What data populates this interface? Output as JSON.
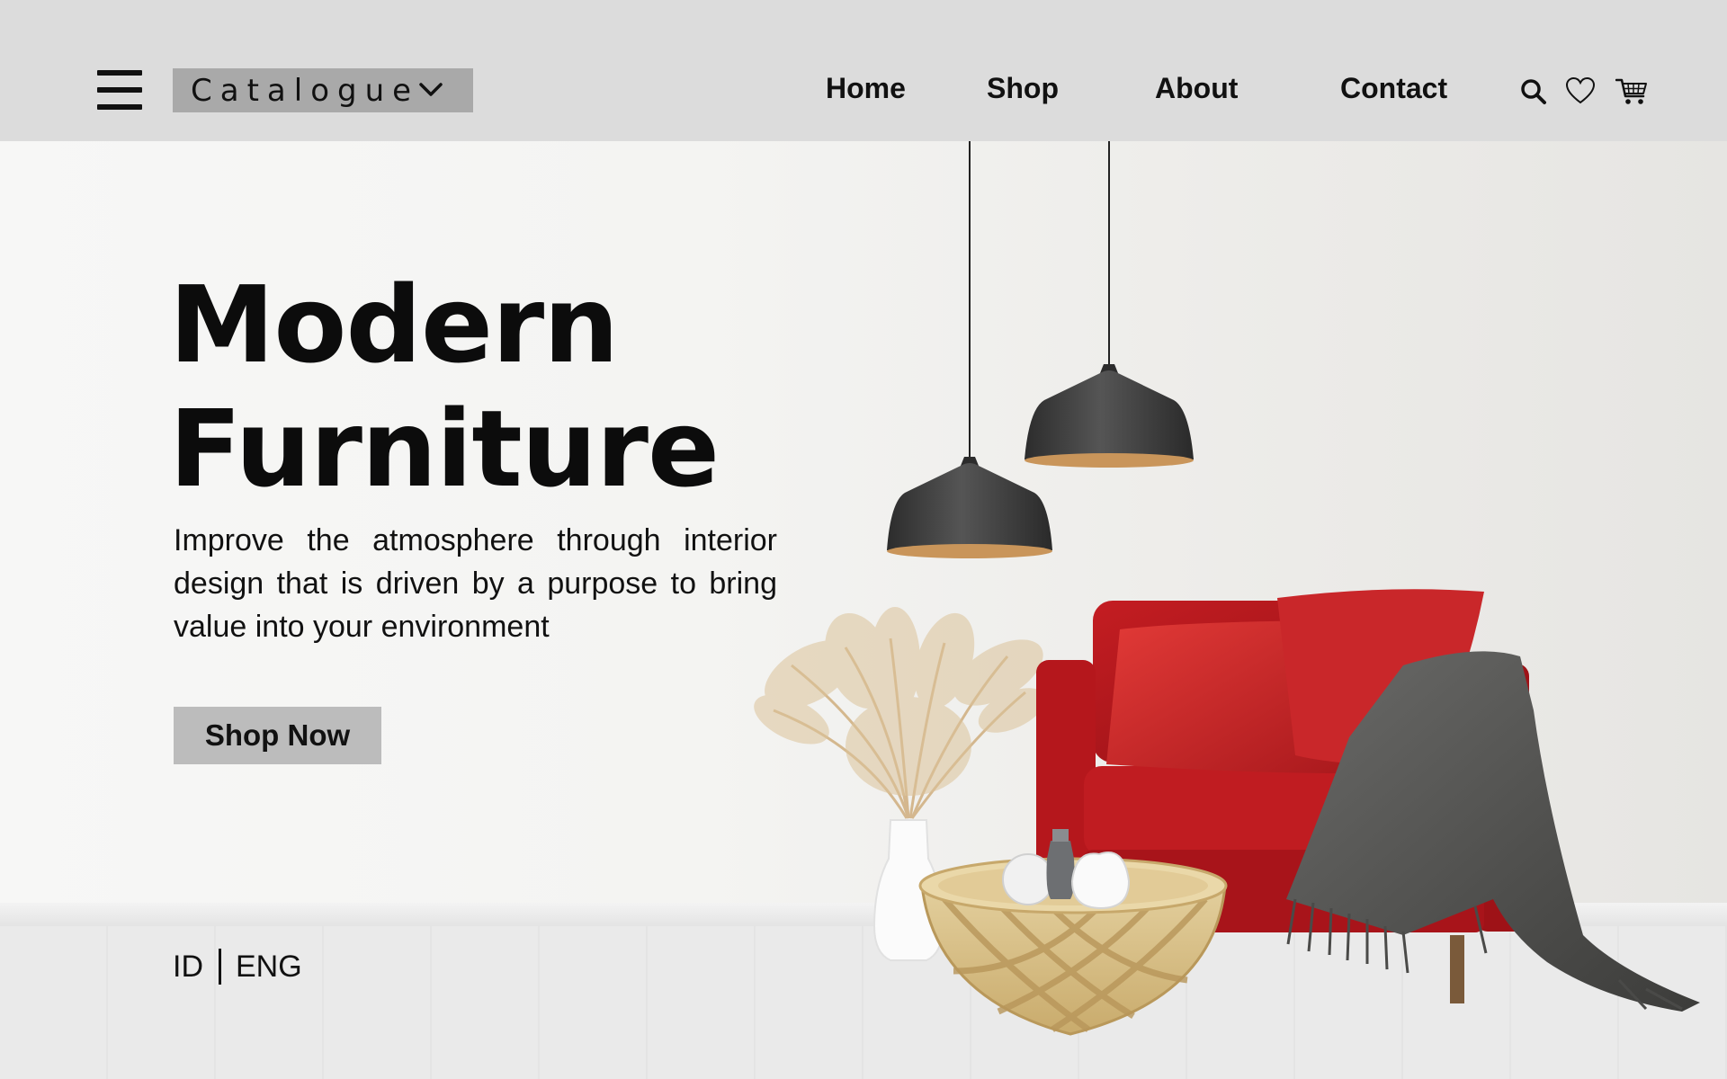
{
  "header": {
    "menu_icon": "hamburger-menu-icon",
    "catalogue": {
      "label": "Catalogue",
      "icon": "chevron-down-icon"
    },
    "nav": [
      {
        "label": "Home"
      },
      {
        "label": "Shop"
      },
      {
        "label": "About"
      },
      {
        "label": "Contact"
      }
    ],
    "icons": [
      "search-icon",
      "heart-icon",
      "cart-icon"
    ]
  },
  "hero": {
    "title_line1": "Modern",
    "title_line2": "Furniture",
    "description": "Improve the atmosphere through interior design that is driven by a purpose to bring value into your environment",
    "cta_label": "Shop Now"
  },
  "language": {
    "options": [
      "ID",
      "ENG"
    ]
  },
  "colors": {
    "header_bg": "#dcdcdc",
    "catalogue_bg": "#a9a9a9",
    "cta_bg": "#bcbcbc",
    "armchair": "#b8161c",
    "lamp": "#3a3a3a",
    "lamp_inner": "#c9955a"
  }
}
